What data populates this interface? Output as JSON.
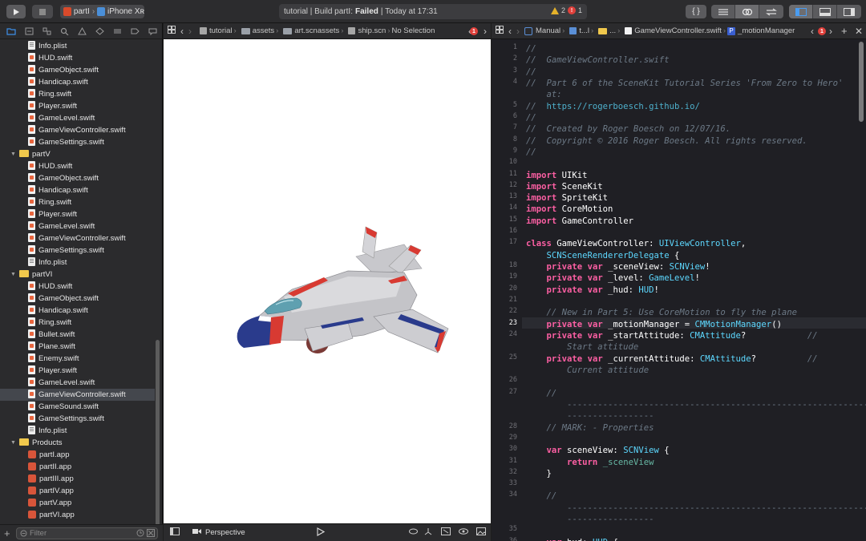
{
  "toolbar": {
    "scheme_app": "partI",
    "scheme_device": "iPhone Xʀ",
    "activity_prefix": "tutorial | Build partI:",
    "activity_status": "Failed",
    "activity_time": "| Today at 17:31",
    "warning_count": "2",
    "error_count": "1",
    "error_count_small": "1"
  },
  "navigator": {
    "rows": [
      {
        "label": "Info.plist",
        "kind": "plist",
        "level": 2
      },
      {
        "label": "HUD.swift",
        "kind": "swift",
        "level": 2
      },
      {
        "label": "GameObject.swift",
        "kind": "swift",
        "level": 2
      },
      {
        "label": "Handicap.swift",
        "kind": "swift",
        "level": 2
      },
      {
        "label": "Ring.swift",
        "kind": "swift",
        "level": 2
      },
      {
        "label": "Player.swift",
        "kind": "swift",
        "level": 2
      },
      {
        "label": "GameLevel.swift",
        "kind": "swift",
        "level": 2
      },
      {
        "label": "GameViewController.swift",
        "kind": "swift",
        "level": 2
      },
      {
        "label": "GameSettings.swift",
        "kind": "swift",
        "level": 2
      },
      {
        "label": "partV",
        "kind": "folder",
        "level": 1
      },
      {
        "label": "HUD.swift",
        "kind": "swift",
        "level": 2
      },
      {
        "label": "GameObject.swift",
        "kind": "swift",
        "level": 2
      },
      {
        "label": "Handicap.swift",
        "kind": "swift",
        "level": 2
      },
      {
        "label": "Ring.swift",
        "kind": "swift",
        "level": 2
      },
      {
        "label": "Player.swift",
        "kind": "swift",
        "level": 2
      },
      {
        "label": "GameLevel.swift",
        "kind": "swift",
        "level": 2
      },
      {
        "label": "GameViewController.swift",
        "kind": "swift",
        "level": 2
      },
      {
        "label": "GameSettings.swift",
        "kind": "swift",
        "level": 2
      },
      {
        "label": "Info.plist",
        "kind": "plist",
        "level": 2
      },
      {
        "label": "partVI",
        "kind": "folder",
        "level": 1
      },
      {
        "label": "HUD.swift",
        "kind": "swift",
        "level": 2
      },
      {
        "label": "GameObject.swift",
        "kind": "swift",
        "level": 2
      },
      {
        "label": "Handicap.swift",
        "kind": "swift",
        "level": 2
      },
      {
        "label": "Ring.swift",
        "kind": "swift",
        "level": 2
      },
      {
        "label": "Bullet.swift",
        "kind": "swift",
        "level": 2
      },
      {
        "label": "Plane.swift",
        "kind": "swift",
        "level": 2
      },
      {
        "label": "Enemy.swift",
        "kind": "swift",
        "level": 2
      },
      {
        "label": "Player.swift",
        "kind": "swift",
        "level": 2
      },
      {
        "label": "GameLevel.swift",
        "kind": "swift",
        "level": 2
      },
      {
        "label": "GameViewController.swift",
        "kind": "swift",
        "level": 2,
        "selected": true
      },
      {
        "label": "GameSound.swift",
        "kind": "swift",
        "level": 2
      },
      {
        "label": "GameSettings.swift",
        "kind": "swift",
        "level": 2
      },
      {
        "label": "Info.plist",
        "kind": "plist",
        "level": 2
      },
      {
        "label": "Products",
        "kind": "folder",
        "level": 1
      },
      {
        "label": "partI.app",
        "kind": "app",
        "level": 2
      },
      {
        "label": "partII.app",
        "kind": "app",
        "level": 2
      },
      {
        "label": "partIII.app",
        "kind": "app",
        "level": 2
      },
      {
        "label": "partIV.app",
        "kind": "app",
        "level": 2
      },
      {
        "label": "partV.app",
        "kind": "app",
        "level": 2
      },
      {
        "label": "partVI.app",
        "kind": "app",
        "level": 2
      }
    ],
    "filter_placeholder": "Filter"
  },
  "scene_editor": {
    "jump": [
      "tutorial",
      "assets",
      "art.scnassets",
      "ship.scn",
      "No Selection"
    ],
    "error_count": "1",
    "camera_label": "Perspective"
  },
  "code_editor": {
    "jump": [
      "Manual",
      "t...l",
      "...",
      "GameViewController.swift",
      "_motionManager"
    ],
    "error_count": "1",
    "current_line": 23,
    "lines": [
      {
        "n": "1",
        "t": [
          [
            "cm",
            "//"
          ]
        ]
      },
      {
        "n": "2",
        "t": [
          [
            "cm",
            "//  GameViewController.swift"
          ]
        ]
      },
      {
        "n": "3",
        "t": [
          [
            "cm",
            "//"
          ]
        ]
      },
      {
        "n": "4",
        "t": [
          [
            "cm",
            "//  Part 6 of the SceneKit Tutorial Series 'From Zero to Hero'"
          ]
        ]
      },
      {
        "n": "",
        "t": [
          [
            "cm",
            "    at:"
          ]
        ]
      },
      {
        "n": "5",
        "t": [
          [
            "cm",
            "//  "
          ],
          [
            "url",
            "https://rogerboesch.github.io/"
          ]
        ]
      },
      {
        "n": "6",
        "t": [
          [
            "cm",
            "//"
          ]
        ]
      },
      {
        "n": "7",
        "t": [
          [
            "cm",
            "//  Created by Roger Boesch on 12/07/16."
          ]
        ]
      },
      {
        "n": "8",
        "t": [
          [
            "cm",
            "//  Copyright © 2016 Roger Boesch. All rights reserved."
          ]
        ]
      },
      {
        "n": "9",
        "t": [
          [
            "cm",
            "//"
          ]
        ]
      },
      {
        "n": "10",
        "t": []
      },
      {
        "n": "11",
        "t": [
          [
            "kw",
            "import"
          ],
          [
            "tx",
            " UIKit"
          ]
        ]
      },
      {
        "n": "12",
        "t": [
          [
            "kw",
            "import"
          ],
          [
            "tx",
            " SceneKit"
          ]
        ]
      },
      {
        "n": "13",
        "t": [
          [
            "kw",
            "import"
          ],
          [
            "tx",
            " SpriteKit"
          ]
        ]
      },
      {
        "n": "14",
        "t": [
          [
            "kw",
            "import"
          ],
          [
            "tx",
            " CoreMotion"
          ]
        ]
      },
      {
        "n": "15",
        "t": [
          [
            "kw",
            "import"
          ],
          [
            "tx",
            " GameController"
          ]
        ]
      },
      {
        "n": "16",
        "t": []
      },
      {
        "n": "17",
        "t": [
          [
            "kw",
            "class"
          ],
          [
            "tx",
            " GameViewController: "
          ],
          [
            "ty",
            "UIViewController"
          ],
          [
            "tx",
            ","
          ]
        ]
      },
      {
        "n": "",
        "t": [
          [
            "ty",
            "    SCNSceneRendererDelegate"
          ],
          [
            "tx",
            " {"
          ]
        ]
      },
      {
        "n": "18",
        "t": [
          [
            "tx",
            "    "
          ],
          [
            "kw",
            "private"
          ],
          [
            "tx",
            " "
          ],
          [
            "kw",
            "var"
          ],
          [
            "tx",
            " _sceneView: "
          ],
          [
            "ty",
            "SCNView"
          ],
          [
            "tx",
            "!"
          ]
        ]
      },
      {
        "n": "19",
        "t": [
          [
            "tx",
            "    "
          ],
          [
            "kw",
            "private"
          ],
          [
            "tx",
            " "
          ],
          [
            "kw",
            "var"
          ],
          [
            "tx",
            " _level: "
          ],
          [
            "ty",
            "GameLevel"
          ],
          [
            "tx",
            "!"
          ]
        ]
      },
      {
        "n": "20",
        "t": [
          [
            "tx",
            "    "
          ],
          [
            "kw",
            "private"
          ],
          [
            "tx",
            " "
          ],
          [
            "kw",
            "var"
          ],
          [
            "tx",
            " _hud: "
          ],
          [
            "ty",
            "HUD"
          ],
          [
            "tx",
            "!"
          ]
        ]
      },
      {
        "n": "21",
        "t": []
      },
      {
        "n": "22",
        "t": [
          [
            "cm",
            "    // New in Part 5: Use CoreMotion to fly the plane"
          ]
        ]
      },
      {
        "n": "23",
        "t": [
          [
            "tx",
            "    "
          ],
          [
            "kw",
            "private"
          ],
          [
            "tx",
            " "
          ],
          [
            "kw",
            "var"
          ],
          [
            "tx",
            " _motionManager = "
          ],
          [
            "ty",
            "CMMotionManager"
          ],
          [
            "tx",
            "()"
          ]
        ]
      },
      {
        "n": "24",
        "t": [
          [
            "tx",
            "    "
          ],
          [
            "kw",
            "private"
          ],
          [
            "tx",
            " "
          ],
          [
            "kw",
            "var"
          ],
          [
            "tx",
            " _startAttitude: "
          ],
          [
            "ty",
            "CMAttitude"
          ],
          [
            "tx",
            "?"
          ],
          [
            "cm",
            "            //"
          ]
        ]
      },
      {
        "n": "",
        "t": [
          [
            "cm",
            "        Start attitude"
          ]
        ]
      },
      {
        "n": "25",
        "t": [
          [
            "tx",
            "    "
          ],
          [
            "kw",
            "private"
          ],
          [
            "tx",
            " "
          ],
          [
            "kw",
            "var"
          ],
          [
            "tx",
            " _currentAttitude: "
          ],
          [
            "ty",
            "CMAttitude"
          ],
          [
            "tx",
            "?"
          ],
          [
            "cm",
            "          //"
          ]
        ]
      },
      {
        "n": "",
        "t": [
          [
            "cm",
            "        Current attitude"
          ]
        ]
      },
      {
        "n": "26",
        "t": []
      },
      {
        "n": "27",
        "t": [
          [
            "cm",
            "    //"
          ]
        ]
      },
      {
        "n": "",
        "t": [
          [
            "dash",
            "        -----------------------------------------------------------"
          ]
        ]
      },
      {
        "n": "",
        "t": [
          [
            "dash",
            "        -----------------"
          ]
        ]
      },
      {
        "n": "28",
        "t": [
          [
            "cm",
            "    // MARK: - Properties"
          ]
        ]
      },
      {
        "n": "29",
        "t": []
      },
      {
        "n": "30",
        "t": [
          [
            "tx",
            "    "
          ],
          [
            "kw",
            "var"
          ],
          [
            "tx",
            " sceneView: "
          ],
          [
            "ty",
            "SCNView"
          ],
          [
            "tx",
            " {"
          ]
        ]
      },
      {
        "n": "31",
        "t": [
          [
            "tx",
            "        "
          ],
          [
            "kw",
            "return"
          ],
          [
            "tx",
            " "
          ],
          [
            "fn",
            "_sceneView"
          ]
        ]
      },
      {
        "n": "32",
        "t": [
          [
            "tx",
            "    }"
          ]
        ]
      },
      {
        "n": "33",
        "t": []
      },
      {
        "n": "34",
        "t": [
          [
            "cm",
            "    //"
          ]
        ]
      },
      {
        "n": "",
        "t": [
          [
            "dash",
            "        -----------------------------------------------------------"
          ]
        ]
      },
      {
        "n": "",
        "t": [
          [
            "dash",
            "        -----------------"
          ]
        ]
      },
      {
        "n": "35",
        "t": []
      },
      {
        "n": "36",
        "t": [
          [
            "tx",
            "    "
          ],
          [
            "kw",
            "var"
          ],
          [
            "tx",
            " hud: "
          ],
          [
            "ty",
            "HUD"
          ],
          [
            "tx",
            " {"
          ]
        ]
      }
    ]
  }
}
